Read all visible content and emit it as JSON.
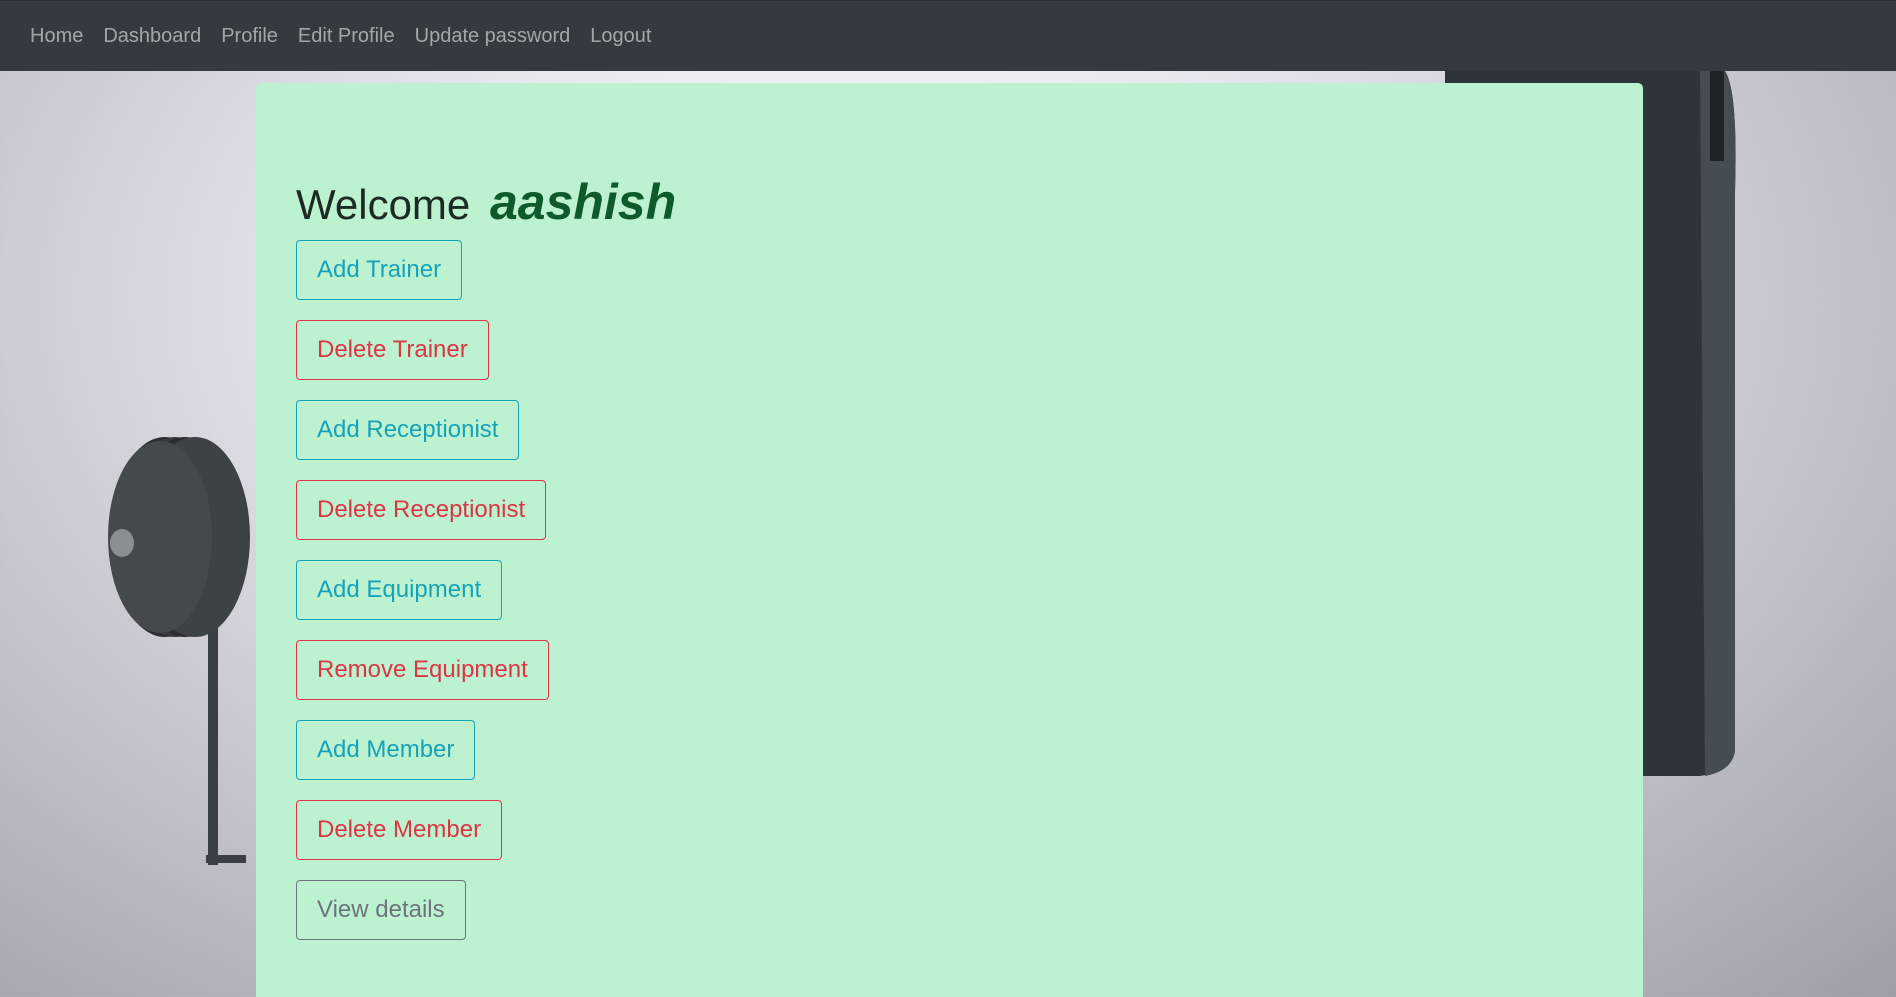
{
  "nav": {
    "items": [
      {
        "label": "Home"
      },
      {
        "label": "Dashboard"
      },
      {
        "label": "Profile"
      },
      {
        "label": "Edit Profile"
      },
      {
        "label": "Update password"
      },
      {
        "label": "Logout"
      }
    ]
  },
  "main": {
    "welcome_label": "Welcome",
    "username": "aashish",
    "buttons": [
      {
        "label": "Add Trainer",
        "style": "info"
      },
      {
        "label": "Delete Trainer",
        "style": "danger"
      },
      {
        "label": "Add Receptionist",
        "style": "info"
      },
      {
        "label": "Delete Receptionist",
        "style": "danger"
      },
      {
        "label": "Add Equipment",
        "style": "info"
      },
      {
        "label": "Remove Equipment",
        "style": "danger"
      },
      {
        "label": "Add Member",
        "style": "info"
      },
      {
        "label": "Delete Member",
        "style": "danger"
      },
      {
        "label": "View details",
        "style": "secondary"
      }
    ]
  },
  "colors": {
    "navbar_bg": "#343a40",
    "panel_bg": "#bdf2d1",
    "info": "#17a2b8",
    "danger": "#dc3545",
    "secondary": "#6c757d",
    "username": "#0f5a2a"
  },
  "background": {
    "icons": [
      "weight-plate-stand-icon",
      "punching-bag-icon"
    ]
  }
}
